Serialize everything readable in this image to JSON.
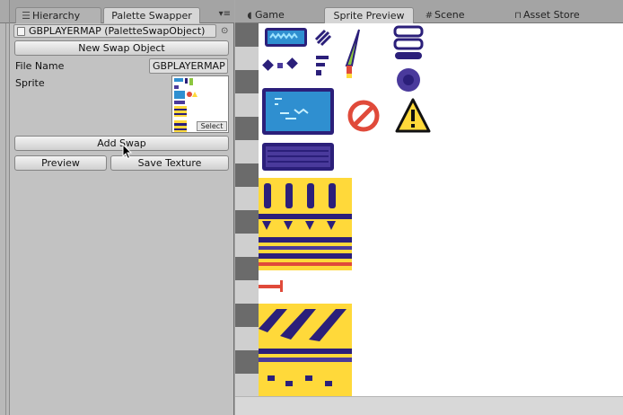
{
  "left_panel": {
    "tabs": [
      {
        "label": "Hierarchy",
        "icon": "list-icon"
      },
      {
        "label": "Palette Swapper"
      }
    ],
    "object_label": "GBPLAYERMAP (PaletteSwapObject)",
    "new_swap_button": "New Swap Object",
    "file_name_label": "File Name",
    "file_name_value": "GBPLAYERMAP",
    "sprite_label": "Sprite",
    "select_label": "Select",
    "add_swap_button": "Add Swap",
    "preview_button": "Preview",
    "save_texture_button": "Save Texture"
  },
  "right_panel": {
    "tabs": [
      {
        "label": "Game",
        "icon": "pacman-icon"
      },
      {
        "label": "Sprite Preview"
      },
      {
        "label": "Scene",
        "icon": "grid-icon"
      },
      {
        "label": "Asset Store",
        "icon": "bag-icon"
      }
    ]
  },
  "colors": {
    "sprite_yellow": "#ffd93a",
    "sprite_navy": "#2b1f7a",
    "sprite_purple": "#4a3a9c",
    "sprite_blue": "#2f8fd0",
    "sprite_red": "#e04a3a"
  }
}
